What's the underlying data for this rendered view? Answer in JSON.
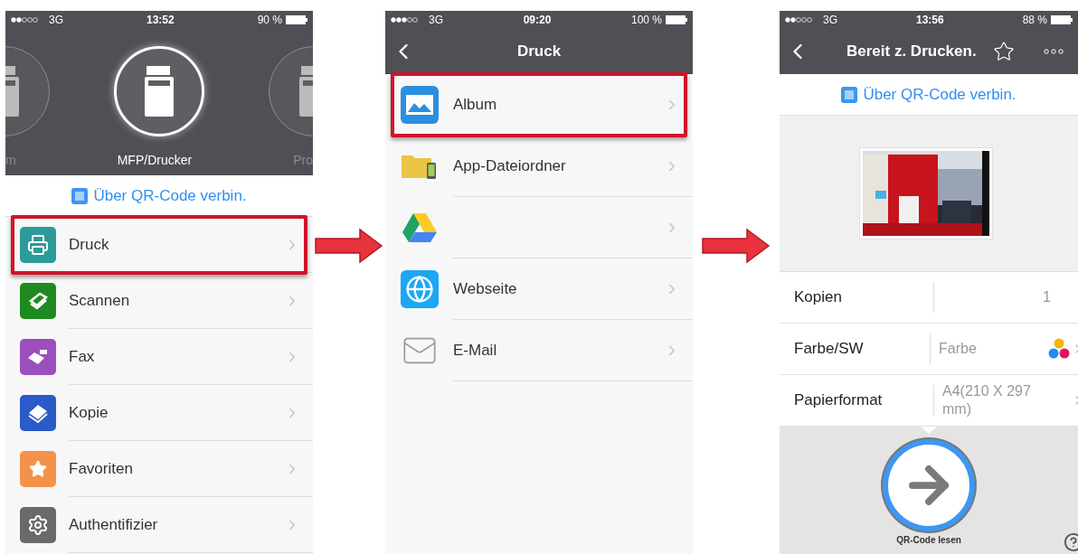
{
  "screens": [
    {
      "status_bar": {
        "network": "3G",
        "time": "13:52",
        "battery": "90 %"
      },
      "carousel": [
        {
          "label": "m",
          "selected": false
        },
        {
          "label": "MFP/Drucker",
          "selected": true
        },
        {
          "label": "Pro",
          "selected": false
        }
      ],
      "qr_link": "Über QR-Code verbin.",
      "menu": [
        {
          "label": "Druck",
          "highlighted": true
        },
        {
          "label": "Scannen",
          "highlighted": false
        },
        {
          "label": "Fax",
          "highlighted": false
        },
        {
          "label": "Kopie",
          "highlighted": false
        },
        {
          "label": "Favoriten",
          "highlighted": false
        },
        {
          "label": "Authentifizier",
          "highlighted": false
        }
      ]
    },
    {
      "status_bar": {
        "network": "3G",
        "time": "09:20",
        "battery": "100 %"
      },
      "title": "Druck",
      "menu": [
        {
          "label": "Album",
          "highlighted": true
        },
        {
          "label": "App-Dateiordner",
          "highlighted": false
        },
        {
          "highlighted": false
        },
        {
          "label": "Webseite",
          "highlighted": false
        },
        {
          "label": "E-Mail",
          "highlighted": false
        }
      ]
    },
    {
      "status_bar": {
        "network": "3G",
        "time": "13:56",
        "battery": "88 %"
      },
      "title": "Bereit z. Drucken.",
      "qr_link": "Über QR-Code verbin.",
      "settings": [
        {
          "label": "Kopien",
          "value": "1"
        },
        {
          "label": "Farbe/SW",
          "value": "Farbe"
        },
        {
          "label": "Papierformat",
          "value": "A4(210 X 297 mm)"
        }
      ],
      "action": "QR-Code lesen"
    }
  ]
}
